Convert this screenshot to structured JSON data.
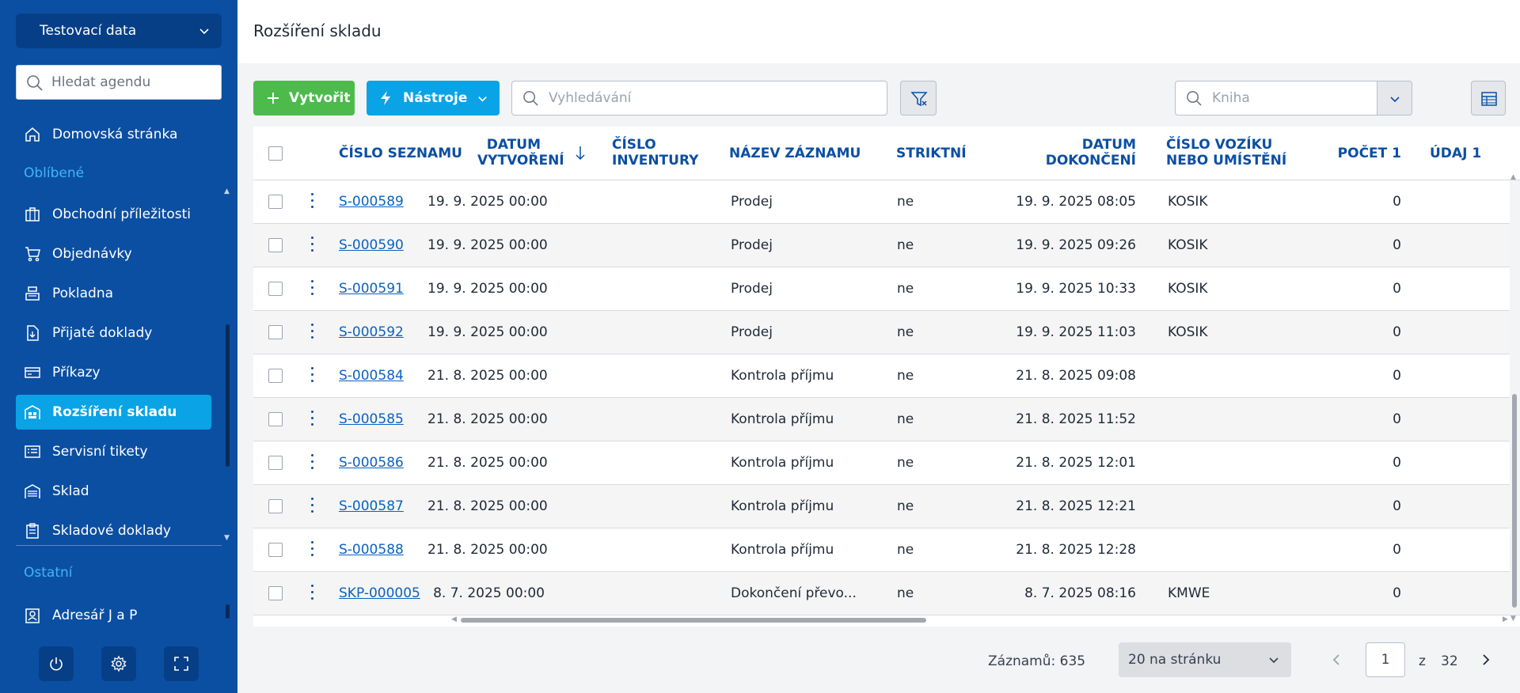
{
  "sidebar": {
    "company": "Testovací data",
    "search_placeholder": "Hledat agendu",
    "home": "Domovská stránka",
    "favorites_label": "Oblíbené",
    "items": [
      {
        "label": "Obchodní příležitosti",
        "icon": "briefcase-icon"
      },
      {
        "label": "Objednávky",
        "icon": "cart-icon"
      },
      {
        "label": "Pokladna",
        "icon": "cash-register-icon"
      },
      {
        "label": "Přijaté doklady",
        "icon": "document-in-icon"
      },
      {
        "label": "Příkazy",
        "icon": "card-icon"
      },
      {
        "label": "Rozšíření skladu",
        "icon": "warehouse-ext-icon",
        "active": true
      },
      {
        "label": "Servisní tikety",
        "icon": "list-icon"
      },
      {
        "label": "Sklad",
        "icon": "warehouse-icon"
      },
      {
        "label": "Skladové doklady",
        "icon": "clipboard-icon"
      }
    ],
    "other_label": "Ostatní",
    "other_items": [
      {
        "label": "Adresář J a P",
        "icon": "contact-icon"
      }
    ]
  },
  "page": {
    "title": "Rozšíření skladu"
  },
  "toolbar": {
    "create_label": "Vytvořit",
    "tools_label": "Nástroje",
    "search_placeholder": "Vyhledávání",
    "book_placeholder": "Kniha"
  },
  "table": {
    "columns": {
      "cislo_seznamu": "ČÍSLO SEZNAMU",
      "datum_vytvoreni_1": "DATUM",
      "datum_vytvoreni_2": "VYTVOŘENÍ",
      "cislo_inventury_1": "ČÍSLO",
      "cislo_inventury_2": "INVENTURY",
      "nazev_zaznamu": "NÁZEV ZÁZNAMU",
      "striktni": "STRIKTNÍ",
      "datum_dokonceni_1": "DATUM",
      "datum_dokonceni_2": "DOKONČENÍ",
      "cislo_voziku_1": "ČÍSLO VOZÍKU",
      "cislo_voziku_2": "NEBO UMÍSTĚNÍ",
      "pocet_1": "POČET 1",
      "udaj_1": "ÚDAJ 1"
    },
    "rows": [
      {
        "cislo": "S-000589",
        "vytvoreni": "19. 9. 2025 00:00",
        "inventura": "",
        "nazev": "Prodej",
        "striktni": "ne",
        "dokonceni": "19. 9. 2025 08:05",
        "vozik": "KOSIK",
        "pocet": "0",
        "udaj": ""
      },
      {
        "cislo": "S-000590",
        "vytvoreni": "19. 9. 2025 00:00",
        "inventura": "",
        "nazev": "Prodej",
        "striktni": "ne",
        "dokonceni": "19. 9. 2025 09:26",
        "vozik": "KOSIK",
        "pocet": "0",
        "udaj": ""
      },
      {
        "cislo": "S-000591",
        "vytvoreni": "19. 9. 2025 00:00",
        "inventura": "",
        "nazev": "Prodej",
        "striktni": "ne",
        "dokonceni": "19. 9. 2025 10:33",
        "vozik": "KOSIK",
        "pocet": "0",
        "udaj": ""
      },
      {
        "cislo": "S-000592",
        "vytvoreni": "19. 9. 2025 00:00",
        "inventura": "",
        "nazev": "Prodej",
        "striktni": "ne",
        "dokonceni": "19. 9. 2025 11:03",
        "vozik": "KOSIK",
        "pocet": "0",
        "udaj": ""
      },
      {
        "cislo": "S-000584",
        "vytvoreni": "21. 8. 2025 00:00",
        "inventura": "",
        "nazev": "Kontrola příjmu",
        "striktni": "ne",
        "dokonceni": "21. 8. 2025 09:08",
        "vozik": "",
        "pocet": "0",
        "udaj": ""
      },
      {
        "cislo": "S-000585",
        "vytvoreni": "21. 8. 2025 00:00",
        "inventura": "",
        "nazev": "Kontrola příjmu",
        "striktni": "ne",
        "dokonceni": "21. 8. 2025 11:52",
        "vozik": "",
        "pocet": "0",
        "udaj": ""
      },
      {
        "cislo": "S-000586",
        "vytvoreni": "21. 8. 2025 00:00",
        "inventura": "",
        "nazev": "Kontrola příjmu",
        "striktni": "ne",
        "dokonceni": "21. 8. 2025 12:01",
        "vozik": "",
        "pocet": "0",
        "udaj": ""
      },
      {
        "cislo": "S-000587",
        "vytvoreni": "21. 8. 2025 00:00",
        "inventura": "",
        "nazev": "Kontrola příjmu",
        "striktni": "ne",
        "dokonceni": "21. 8. 2025 12:21",
        "vozik": "",
        "pocet": "0",
        "udaj": ""
      },
      {
        "cislo": "S-000588",
        "vytvoreni": "21. 8. 2025 00:00",
        "inventura": "",
        "nazev": "Kontrola příjmu",
        "striktni": "ne",
        "dokonceni": "21. 8. 2025 12:28",
        "vozik": "",
        "pocet": "0",
        "udaj": ""
      },
      {
        "cislo": "SKP-000005",
        "vytvoreni": "8. 7. 2025 00:00",
        "inventura": "",
        "nazev": "Dokončení převo...",
        "striktni": "ne",
        "dokonceni": "8. 7. 2025 08:16",
        "vozik": "KMWE",
        "pocet": "0",
        "udaj": ""
      }
    ]
  },
  "footer": {
    "records": "Záznamů: 635",
    "page_size": "20 na stránku",
    "current_page": "1",
    "of_label": "z",
    "total_pages": "32"
  },
  "colors": {
    "sidebar_bg": "#0b4fa3",
    "active_item": "#0aa3e6",
    "create_button": "#4cbb4c",
    "tools_button": "#0aa3e6",
    "header_text": "#0b4fa3",
    "link": "#0b62c0"
  }
}
